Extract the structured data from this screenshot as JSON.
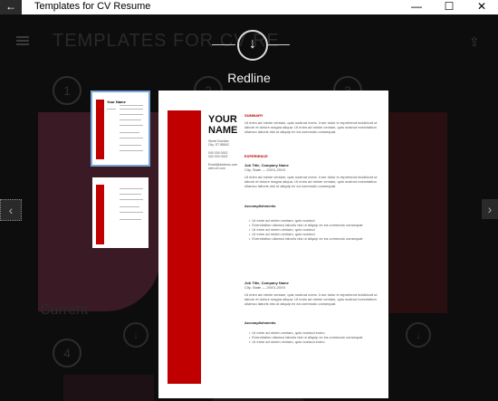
{
  "window": {
    "title": "Templates for CV Resume",
    "back_glyph": "←",
    "minimize_glyph": "—",
    "maximize_glyph": "☐",
    "close_glyph": "✕"
  },
  "background": {
    "title": "TEMPLATES FOR CV RE",
    "numbers": [
      "1",
      "2",
      "3",
      "4"
    ],
    "current_label": "Current",
    "share_glyph": "⇪",
    "download_glyph": "↓"
  },
  "overlay": {
    "download_glyph": "↓",
    "template_name": "Redline",
    "nav_left_glyph": "‹",
    "nav_right_glyph": "›"
  },
  "resume": {
    "name_line1": "YOUR",
    "name_line2": "NAME",
    "street": "Street Number",
    "city": "City, ST 85842",
    "phone1": "000 000 0002",
    "phone2": "000 000 0002",
    "email": "Email@address.com",
    "website": "web.url.com",
    "summary_heading": "SUMMARY",
    "summary_text": "Ut enim ad minim veniam, quis nostrud exerc. Irure dolor in reprehend incididunt ut labore et dolore magna aliqua. Ut enim ad minim veniam, quis nostrud exercitation ullamco laboris nisi ut aliquip ex ea commodo consequat.",
    "experience_heading": "EXPERIENCE",
    "jobs": [
      {
        "title": "Job Title, Company Name",
        "dates": "City, State — 20XX-20XX",
        "text": "Ut enim ad minim veniam, quis nostrud exerc. Irure dolor in reprehend incididunt ut labore et dolore magna aliqua. Ut enim ad minim veniam, quis nostrud exercitation ullamco laboris nisi ut aliquip ex ea commodo consequat.",
        "accomplishments_label": "Accomplishments",
        "bullets": [
          "Ut enim ad minim veniam, quis nostrud",
          "Exercitation ullamco laboris nisi ut aliquip ex ea commodo consequat",
          "Ut enim ad minim veniam, quis nostrud",
          "Ut enim ad minim veniam, quis nostrud",
          "Exercitation ullamco laboris nisi ut aliquip ex ea commodo consequat"
        ]
      },
      {
        "title": "Job Title, Company Name",
        "dates": "City, State — 20XX-20XX",
        "text": "Ut enim ad minim veniam, quis nostrud exerc. Irure dolor in reprehend incididunt ut labore et dolore magna aliqua. Ut enim ad minim veniam, quis nostrud exercitation ullamco laboris nisi ut aliquip ex ea commodo consequat.",
        "accomplishments_label": "Accomplishments",
        "bullets": [
          "Ut enim ad minim veniam, quis nostrud exerc.",
          "Exercitation ullamco laboris nisi ut aliquip ex ea commodo consequat",
          "Ut enim ad minim veniam, quis nostrud exerc."
        ]
      }
    ]
  },
  "thumbnail": {
    "name": "Your Name"
  }
}
